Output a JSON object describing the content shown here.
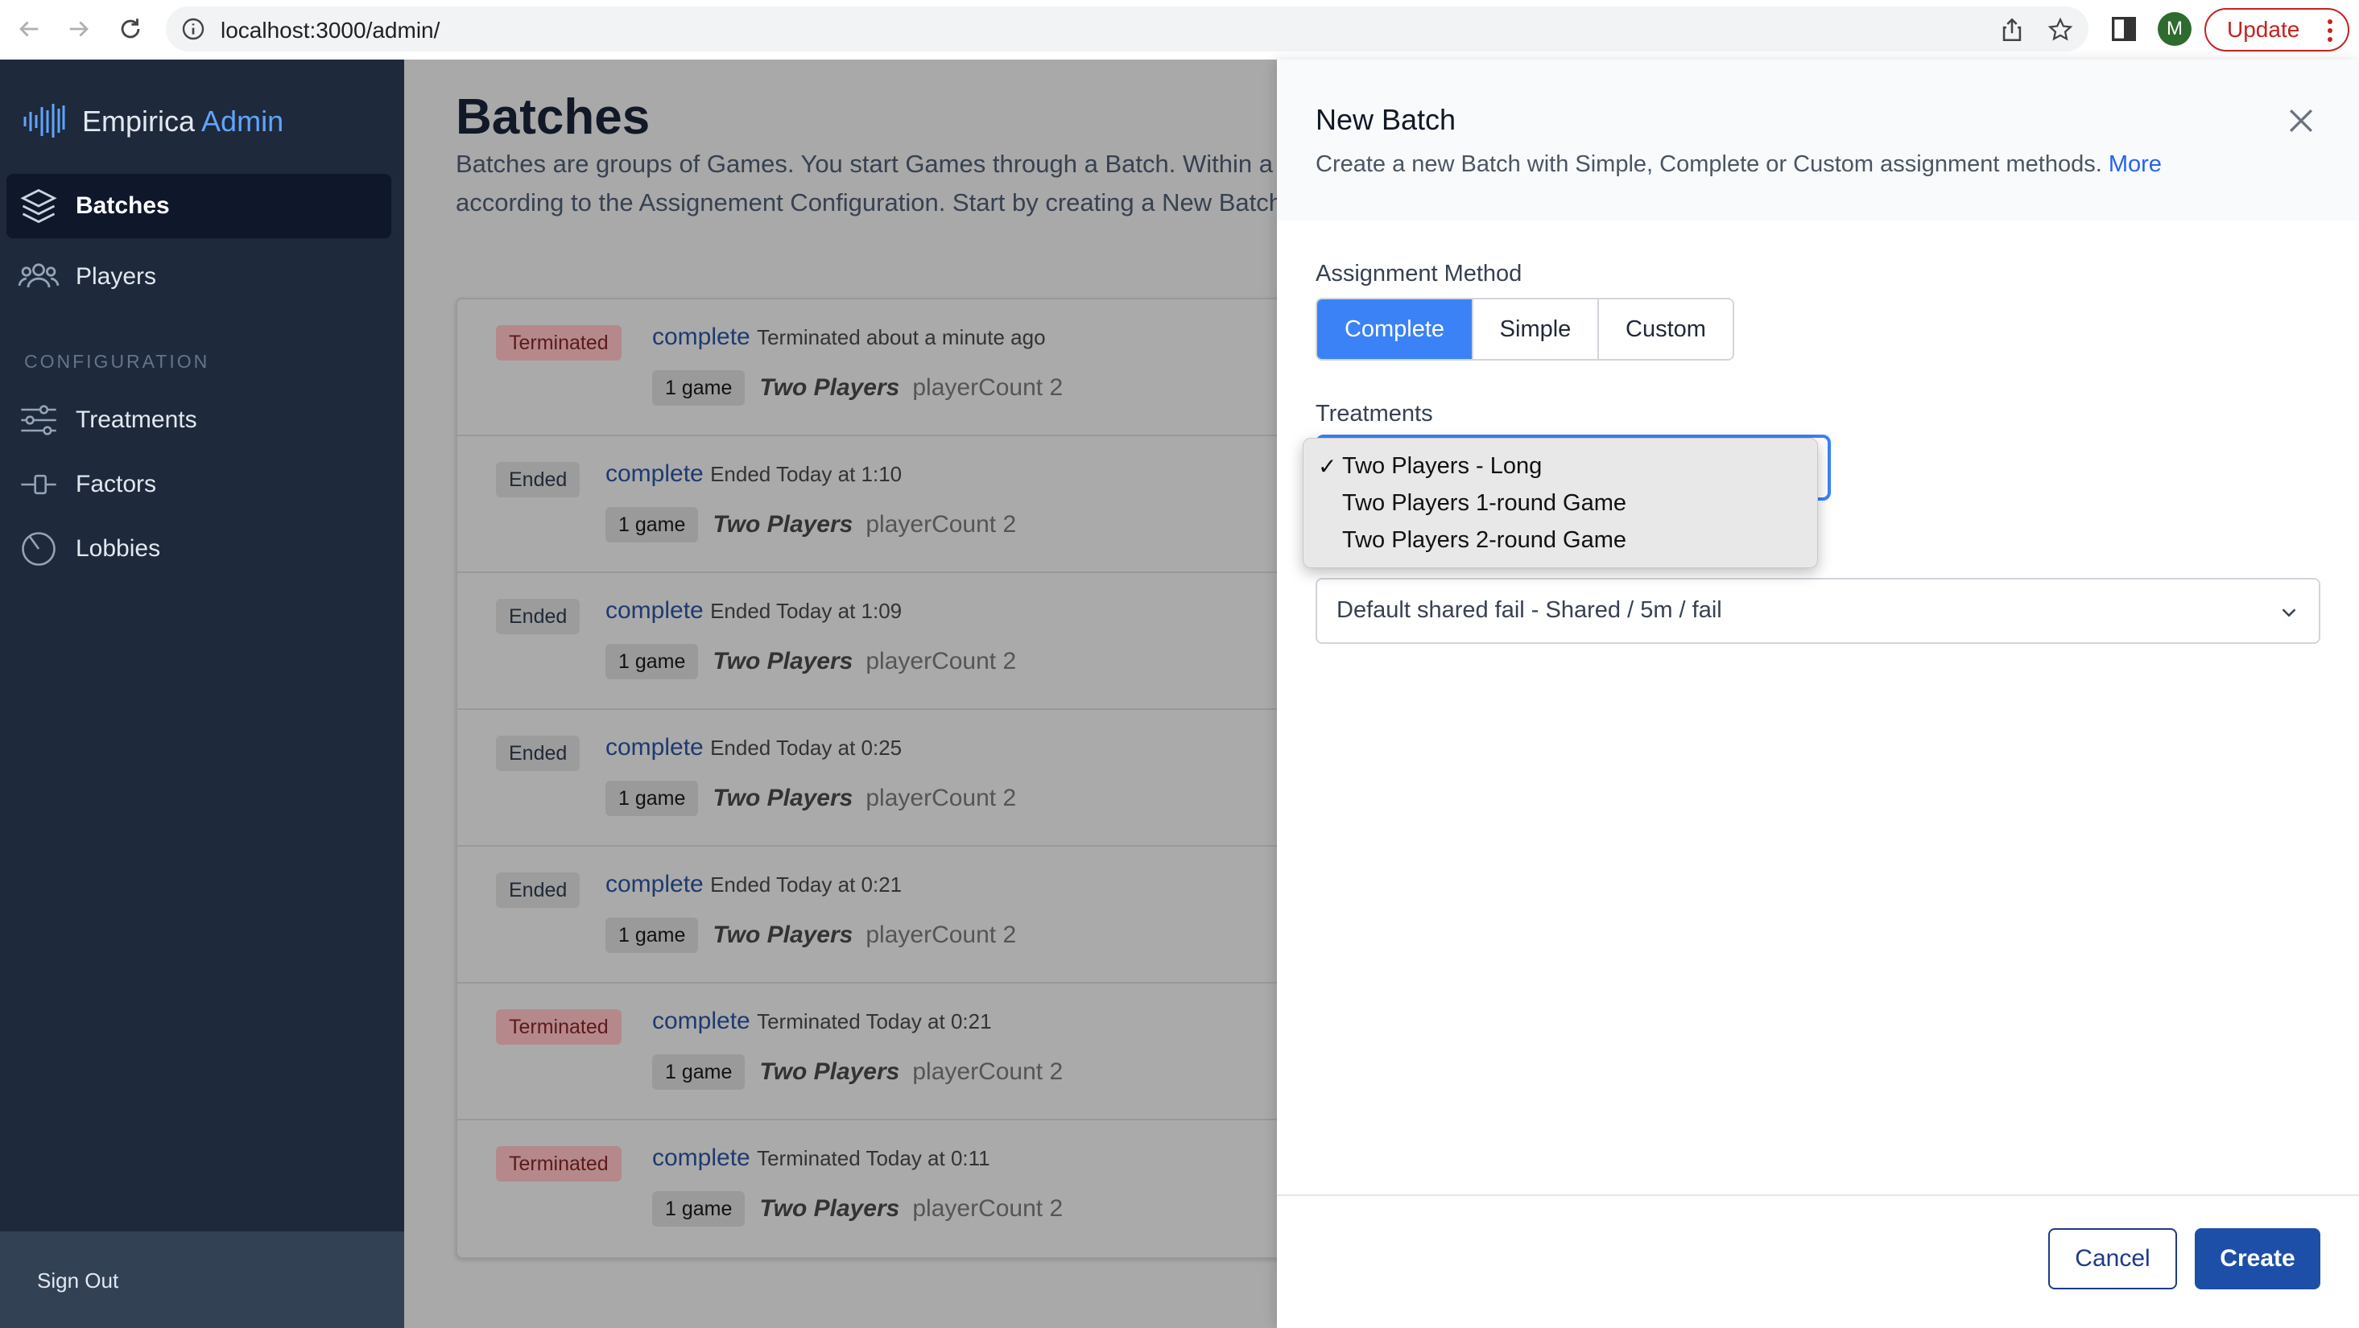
{
  "browser": {
    "url": "localhost:3000/admin/",
    "avatar_letter": "M",
    "update_label": "Update"
  },
  "sidebar": {
    "brand": "Empirica",
    "brand_accent": "Admin",
    "items": [
      {
        "label": "Batches",
        "icon": "layers-icon",
        "active": true
      },
      {
        "label": "Players",
        "icon": "users-icon",
        "active": false
      }
    ],
    "section_label": "CONFIGURATION",
    "config_items": [
      {
        "label": "Treatments",
        "icon": "sliders-icon"
      },
      {
        "label": "Factors",
        "icon": "factor-icon"
      },
      {
        "label": "Lobbies",
        "icon": "timer-icon"
      }
    ],
    "sign_out": "Sign Out"
  },
  "main": {
    "title": "Batches",
    "description": "Batches are groups of Games. You start Games through a Batch. Within a Batch, Games are created according to the Assignement Configuration. Start by creating a New Batch.",
    "batches": [
      {
        "status": "Terminated",
        "kind": "complete",
        "when": "Terminated about a minute ago",
        "games": "1 game",
        "treatment": "Two Players",
        "factor": "playerCount 2"
      },
      {
        "status": "Ended",
        "kind": "complete",
        "when": "Ended Today at 1:10",
        "games": "1 game",
        "treatment": "Two Players",
        "factor": "playerCount 2"
      },
      {
        "status": "Ended",
        "kind": "complete",
        "when": "Ended Today at 1:09",
        "games": "1 game",
        "treatment": "Two Players",
        "factor": "playerCount 2"
      },
      {
        "status": "Ended",
        "kind": "complete",
        "when": "Ended Today at 0:25",
        "games": "1 game",
        "treatment": "Two Players",
        "factor": "playerCount 2"
      },
      {
        "status": "Ended",
        "kind": "complete",
        "when": "Ended Today at 0:21",
        "games": "1 game",
        "treatment": "Two Players",
        "factor": "playerCount 2"
      },
      {
        "status": "Terminated",
        "kind": "complete",
        "when": "Terminated Today at 0:21",
        "games": "1 game",
        "treatment": "Two Players",
        "factor": "playerCount 2"
      },
      {
        "status": "Terminated",
        "kind": "complete",
        "when": "Terminated Today at 0:11",
        "games": "1 game",
        "treatment": "Two Players",
        "factor": "playerCount 2"
      }
    ]
  },
  "drawer": {
    "title": "New Batch",
    "description": "Create a new Batch with Simple, Complete or Custom assignment methods.",
    "more_link": "More",
    "assignment_label": "Assignment Method",
    "methods": [
      "Complete",
      "Simple",
      "Custom"
    ],
    "selected_method": "Complete",
    "treatments_label": "Treatments",
    "treatment_options": [
      "Two Players - Long",
      "Two Players 1-round Game",
      "Two Players 2-round Game"
    ],
    "selected_treatment": "Two Players - Long",
    "lobby_value": "Default shared fail - Shared / 5m / fail",
    "cancel_label": "Cancel",
    "create_label": "Create"
  },
  "colors": {
    "sidebar_bg": "#1e293b",
    "accent": "#3b82f6",
    "primary_button": "#1e4fa8",
    "terminated_badge": "#b5898b"
  }
}
